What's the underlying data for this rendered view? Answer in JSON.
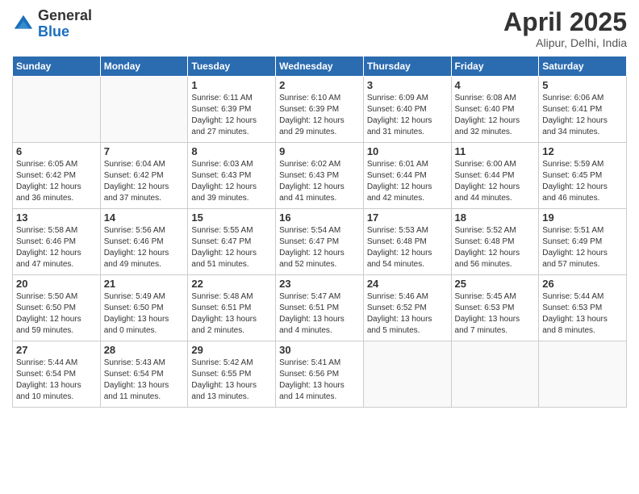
{
  "logo": {
    "general": "General",
    "blue": "Blue"
  },
  "title": "April 2025",
  "location": "Alipur, Delhi, India",
  "days_of_week": [
    "Sunday",
    "Monday",
    "Tuesday",
    "Wednesday",
    "Thursday",
    "Friday",
    "Saturday"
  ],
  "weeks": [
    [
      {
        "day": "",
        "sunrise": "",
        "sunset": "",
        "daylight": ""
      },
      {
        "day": "",
        "sunrise": "",
        "sunset": "",
        "daylight": ""
      },
      {
        "day": "1",
        "sunrise": "Sunrise: 6:11 AM",
        "sunset": "Sunset: 6:39 PM",
        "daylight": "Daylight: 12 hours and 27 minutes."
      },
      {
        "day": "2",
        "sunrise": "Sunrise: 6:10 AM",
        "sunset": "Sunset: 6:39 PM",
        "daylight": "Daylight: 12 hours and 29 minutes."
      },
      {
        "day": "3",
        "sunrise": "Sunrise: 6:09 AM",
        "sunset": "Sunset: 6:40 PM",
        "daylight": "Daylight: 12 hours and 31 minutes."
      },
      {
        "day": "4",
        "sunrise": "Sunrise: 6:08 AM",
        "sunset": "Sunset: 6:40 PM",
        "daylight": "Daylight: 12 hours and 32 minutes."
      },
      {
        "day": "5",
        "sunrise": "Sunrise: 6:06 AM",
        "sunset": "Sunset: 6:41 PM",
        "daylight": "Daylight: 12 hours and 34 minutes."
      }
    ],
    [
      {
        "day": "6",
        "sunrise": "Sunrise: 6:05 AM",
        "sunset": "Sunset: 6:42 PM",
        "daylight": "Daylight: 12 hours and 36 minutes."
      },
      {
        "day": "7",
        "sunrise": "Sunrise: 6:04 AM",
        "sunset": "Sunset: 6:42 PM",
        "daylight": "Daylight: 12 hours and 37 minutes."
      },
      {
        "day": "8",
        "sunrise": "Sunrise: 6:03 AM",
        "sunset": "Sunset: 6:43 PM",
        "daylight": "Daylight: 12 hours and 39 minutes."
      },
      {
        "day": "9",
        "sunrise": "Sunrise: 6:02 AM",
        "sunset": "Sunset: 6:43 PM",
        "daylight": "Daylight: 12 hours and 41 minutes."
      },
      {
        "day": "10",
        "sunrise": "Sunrise: 6:01 AM",
        "sunset": "Sunset: 6:44 PM",
        "daylight": "Daylight: 12 hours and 42 minutes."
      },
      {
        "day": "11",
        "sunrise": "Sunrise: 6:00 AM",
        "sunset": "Sunset: 6:44 PM",
        "daylight": "Daylight: 12 hours and 44 minutes."
      },
      {
        "day": "12",
        "sunrise": "Sunrise: 5:59 AM",
        "sunset": "Sunset: 6:45 PM",
        "daylight": "Daylight: 12 hours and 46 minutes."
      }
    ],
    [
      {
        "day": "13",
        "sunrise": "Sunrise: 5:58 AM",
        "sunset": "Sunset: 6:46 PM",
        "daylight": "Daylight: 12 hours and 47 minutes."
      },
      {
        "day": "14",
        "sunrise": "Sunrise: 5:56 AM",
        "sunset": "Sunset: 6:46 PM",
        "daylight": "Daylight: 12 hours and 49 minutes."
      },
      {
        "day": "15",
        "sunrise": "Sunrise: 5:55 AM",
        "sunset": "Sunset: 6:47 PM",
        "daylight": "Daylight: 12 hours and 51 minutes."
      },
      {
        "day": "16",
        "sunrise": "Sunrise: 5:54 AM",
        "sunset": "Sunset: 6:47 PM",
        "daylight": "Daylight: 12 hours and 52 minutes."
      },
      {
        "day": "17",
        "sunrise": "Sunrise: 5:53 AM",
        "sunset": "Sunset: 6:48 PM",
        "daylight": "Daylight: 12 hours and 54 minutes."
      },
      {
        "day": "18",
        "sunrise": "Sunrise: 5:52 AM",
        "sunset": "Sunset: 6:48 PM",
        "daylight": "Daylight: 12 hours and 56 minutes."
      },
      {
        "day": "19",
        "sunrise": "Sunrise: 5:51 AM",
        "sunset": "Sunset: 6:49 PM",
        "daylight": "Daylight: 12 hours and 57 minutes."
      }
    ],
    [
      {
        "day": "20",
        "sunrise": "Sunrise: 5:50 AM",
        "sunset": "Sunset: 6:50 PM",
        "daylight": "Daylight: 12 hours and 59 minutes."
      },
      {
        "day": "21",
        "sunrise": "Sunrise: 5:49 AM",
        "sunset": "Sunset: 6:50 PM",
        "daylight": "Daylight: 13 hours and 0 minutes."
      },
      {
        "day": "22",
        "sunrise": "Sunrise: 5:48 AM",
        "sunset": "Sunset: 6:51 PM",
        "daylight": "Daylight: 13 hours and 2 minutes."
      },
      {
        "day": "23",
        "sunrise": "Sunrise: 5:47 AM",
        "sunset": "Sunset: 6:51 PM",
        "daylight": "Daylight: 13 hours and 4 minutes."
      },
      {
        "day": "24",
        "sunrise": "Sunrise: 5:46 AM",
        "sunset": "Sunset: 6:52 PM",
        "daylight": "Daylight: 13 hours and 5 minutes."
      },
      {
        "day": "25",
        "sunrise": "Sunrise: 5:45 AM",
        "sunset": "Sunset: 6:53 PM",
        "daylight": "Daylight: 13 hours and 7 minutes."
      },
      {
        "day": "26",
        "sunrise": "Sunrise: 5:44 AM",
        "sunset": "Sunset: 6:53 PM",
        "daylight": "Daylight: 13 hours and 8 minutes."
      }
    ],
    [
      {
        "day": "27",
        "sunrise": "Sunrise: 5:44 AM",
        "sunset": "Sunset: 6:54 PM",
        "daylight": "Daylight: 13 hours and 10 minutes."
      },
      {
        "day": "28",
        "sunrise": "Sunrise: 5:43 AM",
        "sunset": "Sunset: 6:54 PM",
        "daylight": "Daylight: 13 hours and 11 minutes."
      },
      {
        "day": "29",
        "sunrise": "Sunrise: 5:42 AM",
        "sunset": "Sunset: 6:55 PM",
        "daylight": "Daylight: 13 hours and 13 minutes."
      },
      {
        "day": "30",
        "sunrise": "Sunrise: 5:41 AM",
        "sunset": "Sunset: 6:56 PM",
        "daylight": "Daylight: 13 hours and 14 minutes."
      },
      {
        "day": "",
        "sunrise": "",
        "sunset": "",
        "daylight": ""
      },
      {
        "day": "",
        "sunrise": "",
        "sunset": "",
        "daylight": ""
      },
      {
        "day": "",
        "sunrise": "",
        "sunset": "",
        "daylight": ""
      }
    ]
  ]
}
